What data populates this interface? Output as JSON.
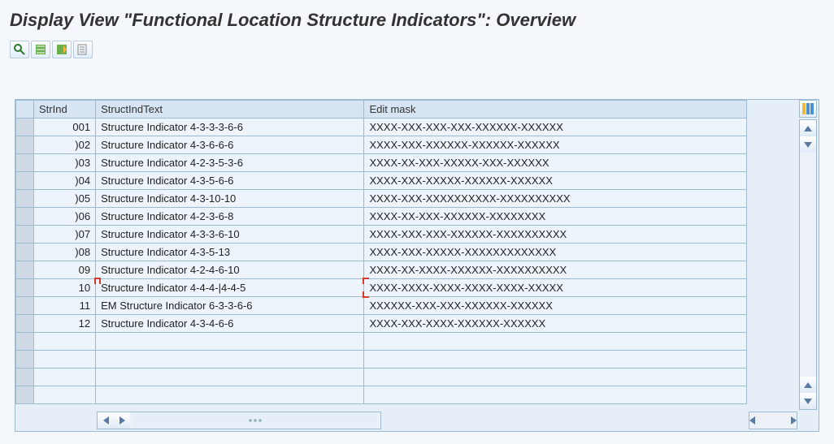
{
  "title": "Display View \"Functional Location Structure Indicators\": Overview",
  "toolbar_icons": [
    "details-icon",
    "expand-all-icon",
    "collapse-icon",
    "print-icon"
  ],
  "columns": {
    "strind": "StrInd",
    "text": "StructIndText",
    "mask": "Edit mask"
  },
  "rows": [
    {
      "strind": "001",
      "text": "Structure Indicator 4-3-3-3-6-6",
      "mask": "XXXX-XXX-XXX-XXX-XXXXXX-XXXXXX"
    },
    {
      "strind": ")02",
      "text": "Structure Indicator 4-3-6-6-6",
      "mask": "XXXX-XXX-XXXXXX-XXXXXX-XXXXXX"
    },
    {
      "strind": ")03",
      "text": "Structure Indicator 4-2-3-5-3-6",
      "mask": "XXXX-XX-XXX-XXXXX-XXX-XXXXXX"
    },
    {
      "strind": ")04",
      "text": "Structure Indicator 4-3-5-6-6",
      "mask": "XXXX-XXX-XXXXX-XXXXXX-XXXXXX"
    },
    {
      "strind": ")05",
      "text": "Structure Indicator 4-3-10-10",
      "mask": "XXXX-XXX-XXXXXXXXXX-XXXXXXXXXX"
    },
    {
      "strind": ")06",
      "text": "Structure Indicator 4-2-3-6-8",
      "mask": "XXXX-XX-XXX-XXXXXX-XXXXXXXX"
    },
    {
      "strind": ")07",
      "text": "Structure Indicator 4-3-3-6-10",
      "mask": "XXXX-XXX-XXX-XXXXXX-XXXXXXXXXX"
    },
    {
      "strind": ")08",
      "text": "Structure Indicator 4-3-5-13",
      "mask": "XXXX-XXX-XXXXX-XXXXXXXXXXXXX"
    },
    {
      "strind": "09",
      "text": "Structure Indicator 4-2-4-6-10",
      "mask": "XXXX-XX-XXXX-XXXXXX-XXXXXXXXXX"
    },
    {
      "strind": "10",
      "text": "Structure Indicator 4-4-4-|4-4-5",
      "mask": "XXXX-XXXX-XXXX-XXXX-XXXX-XXXXX",
      "active": true
    },
    {
      "strind": "11",
      "text": "EM Structure Indicator 6-3-3-6-6",
      "mask": "XXXXXX-XXX-XXX-XXXXXX-XXXXXX"
    },
    {
      "strind": "12",
      "text": "Structure Indicator 4-3-4-6-6",
      "mask": "XXXX-XXX-XXXX-XXXXXX-XXXXXX"
    }
  ]
}
